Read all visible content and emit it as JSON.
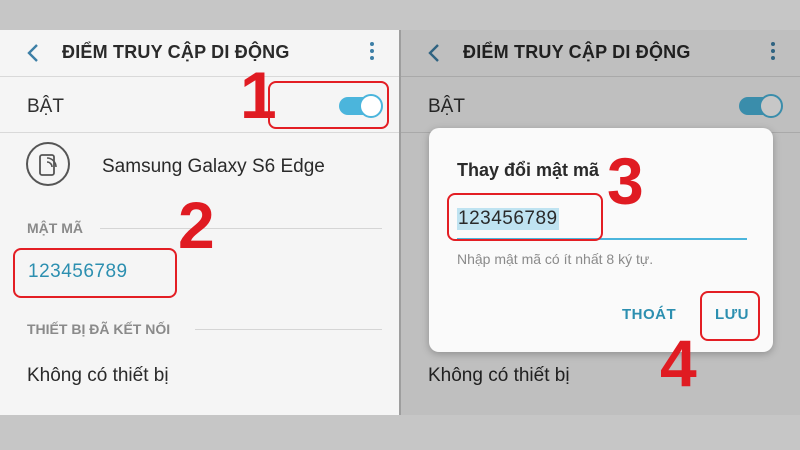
{
  "colors": {
    "accent": "#2c8fb0",
    "toggle": "#4bb5dc",
    "annotation": "#e01b22"
  },
  "left": {
    "header": {
      "title": "ĐIỂM TRUY CẬP DI ĐỘNG",
      "back_icon": "chevron-left-icon",
      "more_icon": "more-vertical-icon"
    },
    "toggle": {
      "label": "BẬT",
      "state": "on"
    },
    "device": {
      "icon": "phone-hotspot-icon",
      "name": "Samsung Galaxy S6 Edge"
    },
    "password": {
      "section": "MẬT MÃ",
      "value": "123456789"
    },
    "connected": {
      "section": "THIẾT BỊ ĐÃ KẾT NỐI",
      "empty_text": "Không có thiết bị"
    }
  },
  "right": {
    "header": {
      "title": "ĐIỂM TRUY CẬP DI ĐỘNG",
      "back_icon": "chevron-left-icon",
      "more_icon": "more-vertical-icon"
    },
    "toggle": {
      "label": "BẬT",
      "state": "on"
    },
    "connected": {
      "empty_text": "Không có thiết bị"
    },
    "dialog": {
      "title": "Thay đổi mật mã",
      "input_value": "123456789",
      "hint": "Nhập mật mã có ít nhất 8 ký tự.",
      "cancel_label": "THOÁT",
      "save_label": "LƯU"
    }
  },
  "annotations": {
    "step1": "1",
    "step2": "2",
    "step3": "3",
    "step4": "4"
  }
}
